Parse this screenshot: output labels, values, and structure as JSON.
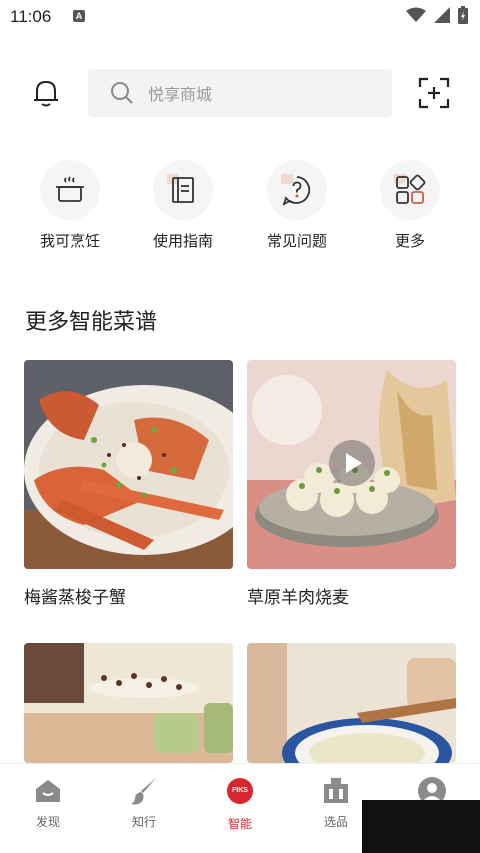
{
  "status_bar": {
    "time": "11:06",
    "notification_letter": "A"
  },
  "search": {
    "placeholder": "悦享商城"
  },
  "quick_actions": [
    {
      "label": "我可烹饪",
      "icon": "pot-icon"
    },
    {
      "label": "使用指南",
      "icon": "book-icon"
    },
    {
      "label": "常见问题",
      "icon": "question-icon"
    },
    {
      "label": "更多",
      "icon": "apps-icon"
    }
  ],
  "section": {
    "title": "更多智能菜谱"
  },
  "recipes": [
    {
      "title": "梅酱蒸梭子蟹",
      "has_video": false
    },
    {
      "title": "草原羊肉烧麦",
      "has_video": true
    },
    {
      "title": "",
      "has_video": false
    },
    {
      "title": "",
      "has_video": false
    }
  ],
  "nav": {
    "items": [
      {
        "label": "发现",
        "icon": "home-icon",
        "active": false
      },
      {
        "label": "知行",
        "icon": "brush-icon",
        "active": false
      },
      {
        "label": "智能",
        "icon": "fiks-logo-icon",
        "active": true,
        "badge_text": "FIKS"
      },
      {
        "label": "选品",
        "icon": "shop-icon",
        "active": false
      },
      {
        "label": "",
        "icon": "profile-icon",
        "active": false
      }
    ]
  },
  "colors": {
    "accent": "#d8262f",
    "search_bg": "#f3f3f3",
    "quick_bg": "#f5f5f5"
  }
}
